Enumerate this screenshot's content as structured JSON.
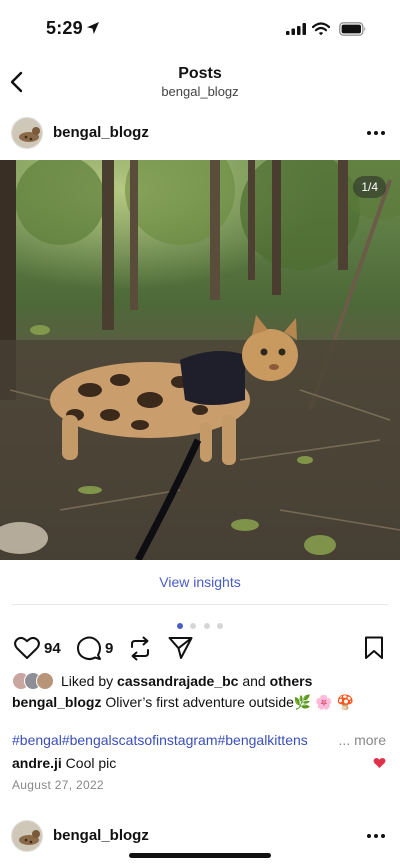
{
  "status_bar": {
    "time": "5:29"
  },
  "header": {
    "title": "Posts",
    "subtitle": "bengal_blogz"
  },
  "post": {
    "username": "bengal_blogz",
    "photo_counter": "1/4",
    "view_insights": "View insights",
    "carousel": {
      "count": 4,
      "active": 0
    },
    "likes": "94",
    "comments": "9",
    "liked_by_prefix": "Liked by ",
    "liked_by_user": "cassandrajade_bc",
    "liked_by_and": " and ",
    "liked_by_others": "others",
    "caption_user": "bengal_blogz",
    "caption_text": " Oliver’s first adventure outside",
    "caption_emoji": "🌿 🌸 🍄",
    "hashtags": "#bengal#bengalscatsofinstagram#bengalkittens",
    "hashtags_more": "... more",
    "comment_user": "andre.ji",
    "comment_text": " Cool pic",
    "date": "August 27, 2022"
  },
  "next_post": {
    "username": "bengal_blogz"
  },
  "colors": {
    "accent": "#4a5cc6",
    "hashtag": "#3b4fb8",
    "heart_red": "#e0334a"
  },
  "icons": [
    "location-arrow-icon",
    "signal-icon",
    "wifi-icon",
    "battery-icon",
    "back-chevron-icon",
    "more-dots-icon",
    "heart-icon",
    "comment-icon",
    "repost-icon",
    "send-icon",
    "bookmark-icon",
    "heart-small-icon"
  ]
}
